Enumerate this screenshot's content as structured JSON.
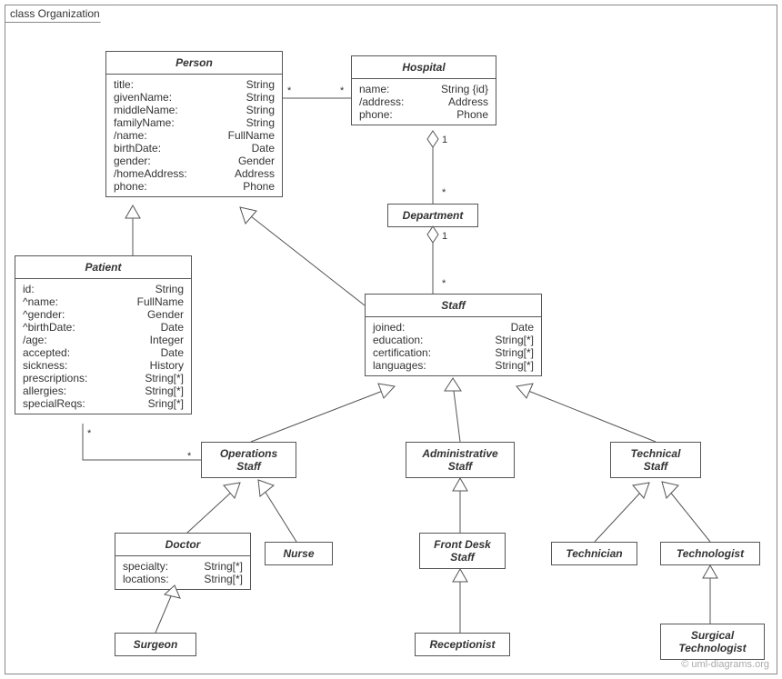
{
  "frame_label": "class Organization",
  "watermark": "© uml-diagrams.org",
  "classes": {
    "person": {
      "title": "Person",
      "attrs": [
        [
          "title:",
          "String"
        ],
        [
          "givenName:",
          "String"
        ],
        [
          "middleName:",
          "String"
        ],
        [
          "familyName:",
          "String"
        ],
        [
          "/name:",
          "FullName"
        ],
        [
          "birthDate:",
          "Date"
        ],
        [
          "gender:",
          "Gender"
        ],
        [
          "/homeAddress:",
          "Address"
        ],
        [
          "phone:",
          "Phone"
        ]
      ]
    },
    "hospital": {
      "title": "Hospital",
      "attrs": [
        [
          "name:",
          "String {id}"
        ],
        [
          "/address:",
          "Address"
        ],
        [
          "phone:",
          "Phone"
        ]
      ]
    },
    "department": {
      "title": "Department"
    },
    "patient": {
      "title": "Patient",
      "attrs": [
        [
          "id:",
          "String"
        ],
        [
          "^name:",
          "FullName"
        ],
        [
          "^gender:",
          "Gender"
        ],
        [
          "^birthDate:",
          "Date"
        ],
        [
          "/age:",
          "Integer"
        ],
        [
          "accepted:",
          "Date"
        ],
        [
          "sickness:",
          "History"
        ],
        [
          "prescriptions:",
          "String[*]"
        ],
        [
          "allergies:",
          "String[*]"
        ],
        [
          "specialReqs:",
          "Sring[*]"
        ]
      ]
    },
    "staff": {
      "title": "Staff",
      "attrs": [
        [
          "joined:",
          "Date"
        ],
        [
          "education:",
          "String[*]"
        ],
        [
          "certification:",
          "String[*]"
        ],
        [
          "languages:",
          "String[*]"
        ]
      ]
    },
    "ops_staff": {
      "title": "Operations\nStaff"
    },
    "admin_staff": {
      "title": "Administrative\nStaff"
    },
    "tech_staff": {
      "title": "Technical\nStaff"
    },
    "doctor": {
      "title": "Doctor",
      "attrs": [
        [
          "specialty:",
          "String[*]"
        ],
        [
          "locations:",
          "String[*]"
        ]
      ]
    },
    "nurse": {
      "title": "Nurse"
    },
    "front_desk": {
      "title": "Front Desk\nStaff"
    },
    "technician": {
      "title": "Technician"
    },
    "technologist": {
      "title": "Technologist"
    },
    "surgeon": {
      "title": "Surgeon"
    },
    "receptionist": {
      "title": "Receptionist"
    },
    "surgical_tech": {
      "title": "Surgical\nTechnologist"
    }
  },
  "mult": {
    "person_hosp_left": "*",
    "person_hosp_right": "*",
    "hosp_dept_top": "1",
    "hosp_dept_bottom": "*",
    "dept_staff_top": "1",
    "dept_staff_bottom": "*",
    "patient_ops_left": "*",
    "patient_ops_right": "*"
  }
}
